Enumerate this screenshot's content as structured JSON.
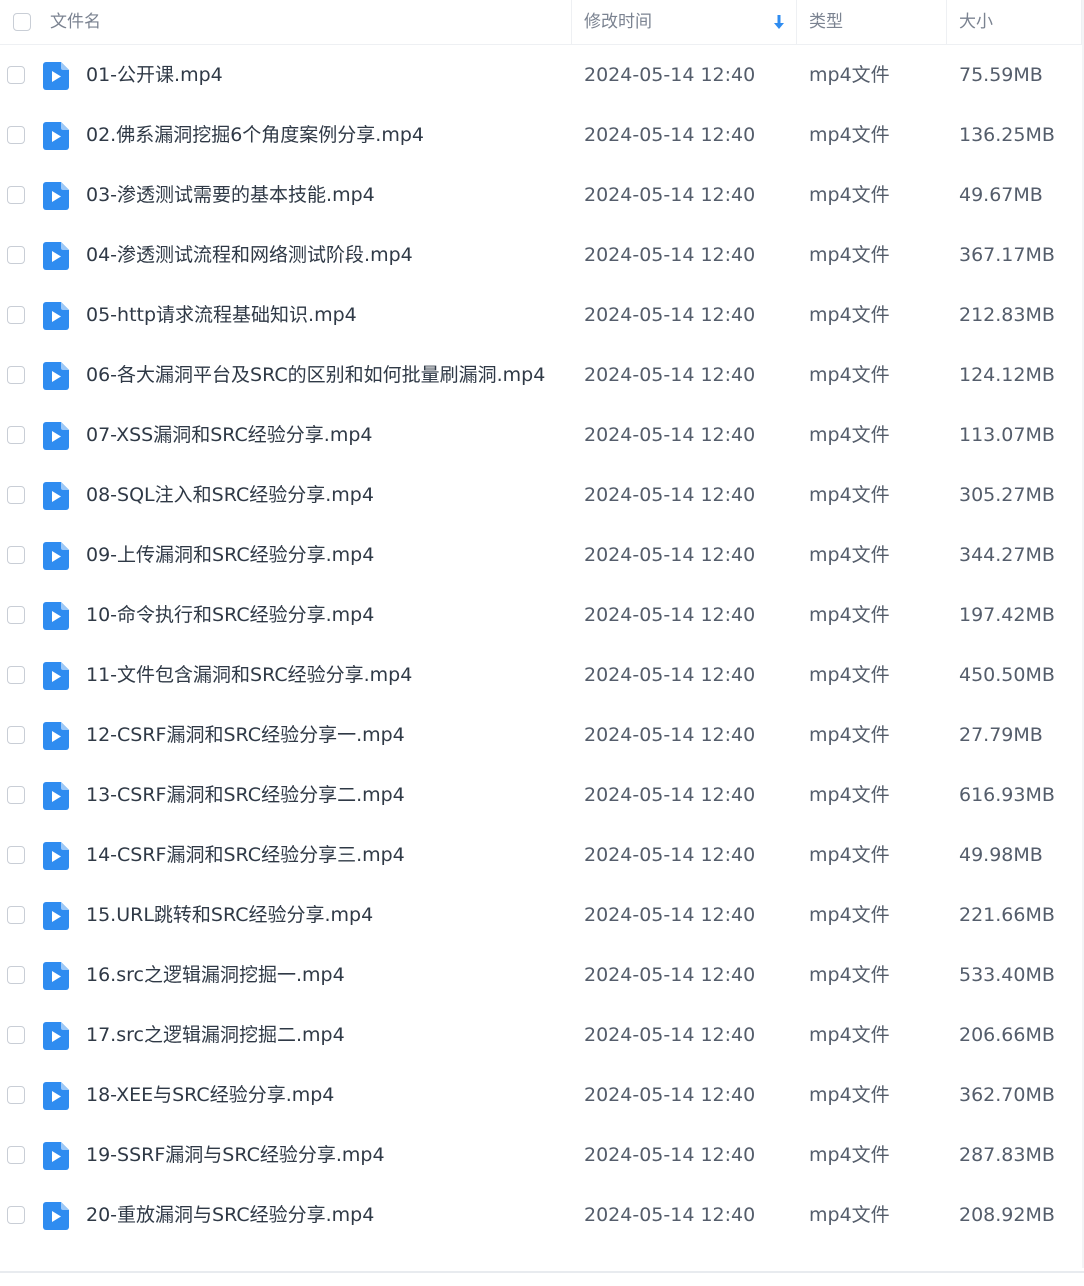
{
  "header": {
    "name_label": "文件名",
    "modified_label": "修改时间",
    "type_label": "类型",
    "size_label": "大小"
  },
  "files": [
    {
      "name": "01-公开课.mp4",
      "modified": "2024-05-14 12:40",
      "type": "mp4文件",
      "size": "75.59MB"
    },
    {
      "name": "02.佛系漏洞挖掘6个角度案例分享.mp4",
      "modified": "2024-05-14 12:40",
      "type": "mp4文件",
      "size": "136.25MB"
    },
    {
      "name": "03-渗透测试需要的基本技能.mp4",
      "modified": "2024-05-14 12:40",
      "type": "mp4文件",
      "size": "49.67MB"
    },
    {
      "name": "04-渗透测试流程和网络测试阶段.mp4",
      "modified": "2024-05-14 12:40",
      "type": "mp4文件",
      "size": "367.17MB"
    },
    {
      "name": "05-http请求流程基础知识.mp4",
      "modified": "2024-05-14 12:40",
      "type": "mp4文件",
      "size": "212.83MB"
    },
    {
      "name": "06-各大漏洞平台及SRC的区别和如何批量刷漏洞.mp4",
      "modified": "2024-05-14 12:40",
      "type": "mp4文件",
      "size": "124.12MB"
    },
    {
      "name": "07-XSS漏洞和SRC经验分享.mp4",
      "modified": "2024-05-14 12:40",
      "type": "mp4文件",
      "size": "113.07MB"
    },
    {
      "name": "08-SQL注入和SRC经验分享.mp4",
      "modified": "2024-05-14 12:40",
      "type": "mp4文件",
      "size": "305.27MB"
    },
    {
      "name": "09-上传漏洞和SRC经验分享.mp4",
      "modified": "2024-05-14 12:40",
      "type": "mp4文件",
      "size": "344.27MB"
    },
    {
      "name": "10-命令执行和SRC经验分享.mp4",
      "modified": "2024-05-14 12:40",
      "type": "mp4文件",
      "size": "197.42MB"
    },
    {
      "name": "11-文件包含漏洞和SRC经验分享.mp4",
      "modified": "2024-05-14 12:40",
      "type": "mp4文件",
      "size": "450.50MB"
    },
    {
      "name": "12-CSRF漏洞和SRC经验分享一.mp4",
      "modified": "2024-05-14 12:40",
      "type": "mp4文件",
      "size": "27.79MB"
    },
    {
      "name": "13-CSRF漏洞和SRC经验分享二.mp4",
      "modified": "2024-05-14 12:40",
      "type": "mp4文件",
      "size": "616.93MB"
    },
    {
      "name": "14-CSRF漏洞和SRC经验分享三.mp4",
      "modified": "2024-05-14 12:40",
      "type": "mp4文件",
      "size": "49.98MB"
    },
    {
      "name": "15.URL跳转和SRC经验分享.mp4",
      "modified": "2024-05-14 12:40",
      "type": "mp4文件",
      "size": "221.66MB"
    },
    {
      "name": "16.src之逻辑漏洞挖掘一.mp4",
      "modified": "2024-05-14 12:40",
      "type": "mp4文件",
      "size": "533.40MB"
    },
    {
      "name": "17.src之逻辑漏洞挖掘二.mp4",
      "modified": "2024-05-14 12:40",
      "type": "mp4文件",
      "size": "206.66MB"
    },
    {
      "name": "18-XEE与SRC经验分享.mp4",
      "modified": "2024-05-14 12:40",
      "type": "mp4文件",
      "size": "362.70MB"
    },
    {
      "name": "19-SSRF漏洞与SRC经验分享.mp4",
      "modified": "2024-05-14 12:40",
      "type": "mp4文件",
      "size": "287.83MB"
    },
    {
      "name": "20-重放漏洞与SRC经验分享.mp4",
      "modified": "2024-05-14 12:40",
      "type": "mp4文件",
      "size": "208.92MB"
    }
  ],
  "colors": {
    "icon_blue": "#2f8cf0",
    "sort_arrow": "#2f8cf0",
    "header_text": "#7b8391"
  }
}
